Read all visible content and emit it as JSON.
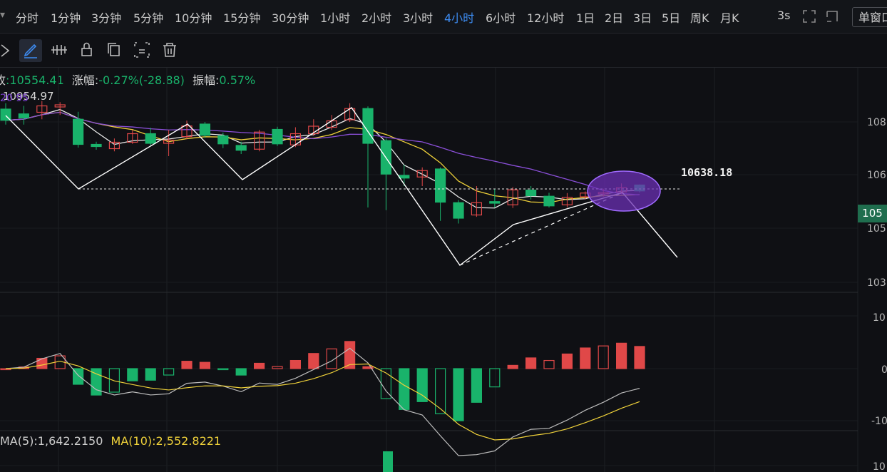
{
  "toolbar": {
    "collapse_arrow": "▾",
    "periods": [
      "分时",
      "1分钟",
      "3分钟",
      "5分钟",
      "10分钟",
      "15分钟",
      "30分钟",
      "1小时",
      "2小时",
      "3小时",
      "4小时",
      "6小时",
      "12小时",
      "1日",
      "2日",
      "3日",
      "5日",
      "周K",
      "月K"
    ],
    "active_period": "4小时",
    "refresh_interval": "3s",
    "layout_button": "单窗口"
  },
  "drawing_tools": [
    "pointer-icon",
    "pen-icon",
    "measure-icon",
    "lock-icon",
    "copy-icon",
    "screenshot-icon",
    "trash-icon"
  ],
  "info": {
    "close_label": "收",
    "close_value": ":10554.41",
    "change_label": "涨幅:",
    "change_value": "-0.27%(-28.88)",
    "amplitude_label": "振幅:",
    "amplitude_value": "0.57%"
  },
  "annotations": {
    "high_price_label": "10954.97",
    "overlay_text": "20 95",
    "level_label": "10638.18"
  },
  "price_axis": [
    "108",
    "106",
    "105",
    "105",
    "103"
  ],
  "current_price_badge": "105",
  "macd_axis": [
    "10",
    "0",
    "-10"
  ],
  "volume_info": {
    "ma5": "MA(5):1,642.2150",
    "ma10": "MA(10):2,552.8221"
  },
  "volume_axis": [
    "10"
  ],
  "colors": {
    "up": "#e04848",
    "down": "#19b36b",
    "ma_white": "#e8e8e8",
    "ma_yellow": "#f0d23a",
    "ma_purple": "#8a4fd8",
    "active_period": "#3d8bf0"
  },
  "chart_data": {
    "type": "candlestick",
    "series": [
      {
        "name": "candles",
        "candles": [
          [
            10848,
            10806,
            10870,
            10790
          ],
          [
            10830,
            10815,
            10860,
            10790
          ],
          [
            10836,
            10860,
            10878,
            10810
          ],
          [
            10856,
            10864,
            10874,
            10826
          ],
          [
            10810,
            10716,
            10838,
            10704
          ],
          [
            10716,
            10708,
            10726,
            10696
          ],
          [
            10700,
            10724,
            10738,
            10690
          ],
          [
            10724,
            10756,
            10770,
            10718
          ],
          [
            10756,
            10720,
            10778,
            10712
          ],
          [
            10720,
            10732,
            10770,
            10672
          ],
          [
            10745,
            10785,
            10805,
            10735
          ],
          [
            10792,
            10750,
            10800,
            10740
          ],
          [
            10748,
            10718,
            10760,
            10702
          ],
          [
            10712,
            10694,
            10726,
            10680
          ],
          [
            10698,
            10762,
            10770,
            10690
          ],
          [
            10772,
            10718,
            10782,
            10710
          ],
          [
            10714,
            10756,
            10780,
            10706
          ],
          [
            10756,
            10784,
            10810,
            10748
          ],
          [
            10780,
            10804,
            10826,
            10770
          ],
          [
            10808,
            10850,
            10870,
            10800
          ],
          [
            10850,
            10720,
            10858,
            10480
          ],
          [
            10730,
            10605,
            10738,
            10470
          ],
          [
            10600,
            10590,
            10640,
            10560
          ],
          [
            10594,
            10618,
            10630,
            10560
          ],
          [
            10624,
            10500,
            10630,
            10430
          ],
          [
            10498,
            10440,
            10508,
            10420
          ],
          [
            10452,
            10498,
            10560,
            10445
          ],
          [
            10502,
            10496,
            10550,
            10480
          ],
          [
            10490,
            10546,
            10556,
            10478
          ],
          [
            10545,
            10524,
            10560,
            10510
          ],
          [
            10522,
            10486,
            10535,
            10480
          ],
          [
            10490,
            10518,
            10534,
            10480
          ],
          [
            10520,
            10534,
            10540,
            10510
          ],
          [
            10531,
            10536,
            10550,
            10520
          ],
          [
            10538,
            10554,
            10570,
            10530
          ],
          [
            10564,
            10542,
            10566,
            10536
          ]
        ]
      }
    ],
    "levels": [
      10638.18
    ],
    "annotations": [
      "10954.97",
      "10638.18"
    ]
  }
}
